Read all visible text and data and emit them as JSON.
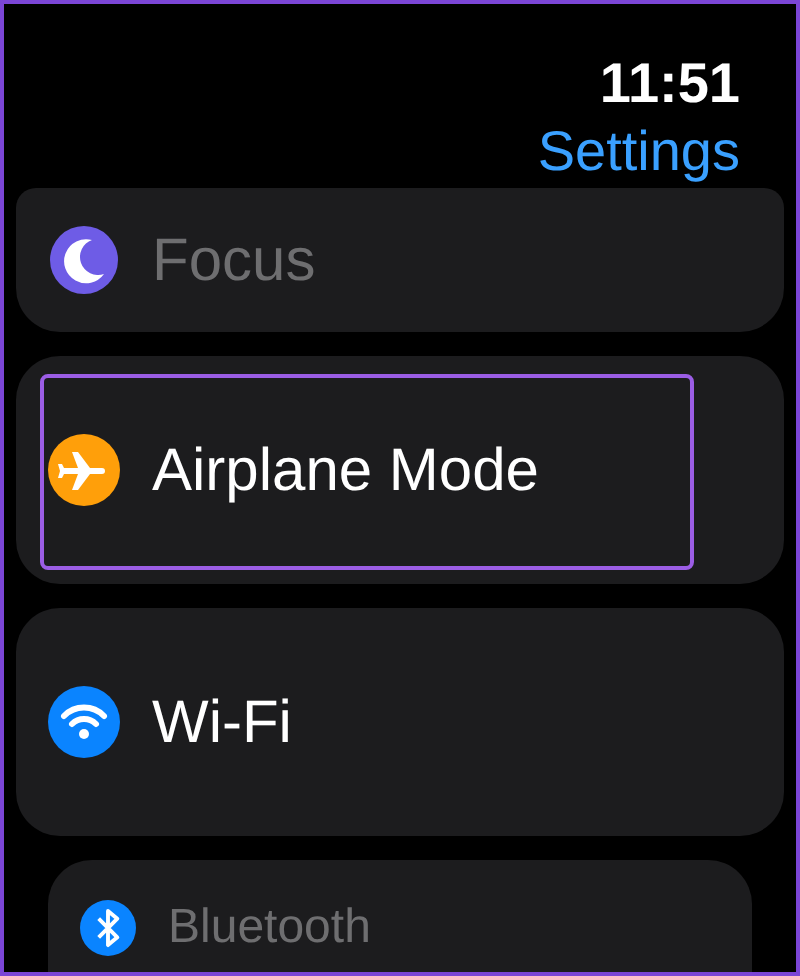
{
  "status_bar": {
    "time": "11:51",
    "title": "Settings"
  },
  "items": [
    {
      "label": "Focus",
      "kind": "focus",
      "color": "#6e5ce6",
      "dimmed": true,
      "highlighted": false
    },
    {
      "label": "Airplane Mode",
      "kind": "airplane",
      "color": "#ff9f0a",
      "dimmed": false,
      "highlighted": true
    },
    {
      "label": "Wi-Fi",
      "kind": "wifi",
      "color": "#0a84ff",
      "dimmed": false,
      "highlighted": false
    },
    {
      "label": "Bluetooth",
      "kind": "bluetooth",
      "color": "#0a84ff",
      "dimmed": true,
      "highlighted": false
    }
  ]
}
